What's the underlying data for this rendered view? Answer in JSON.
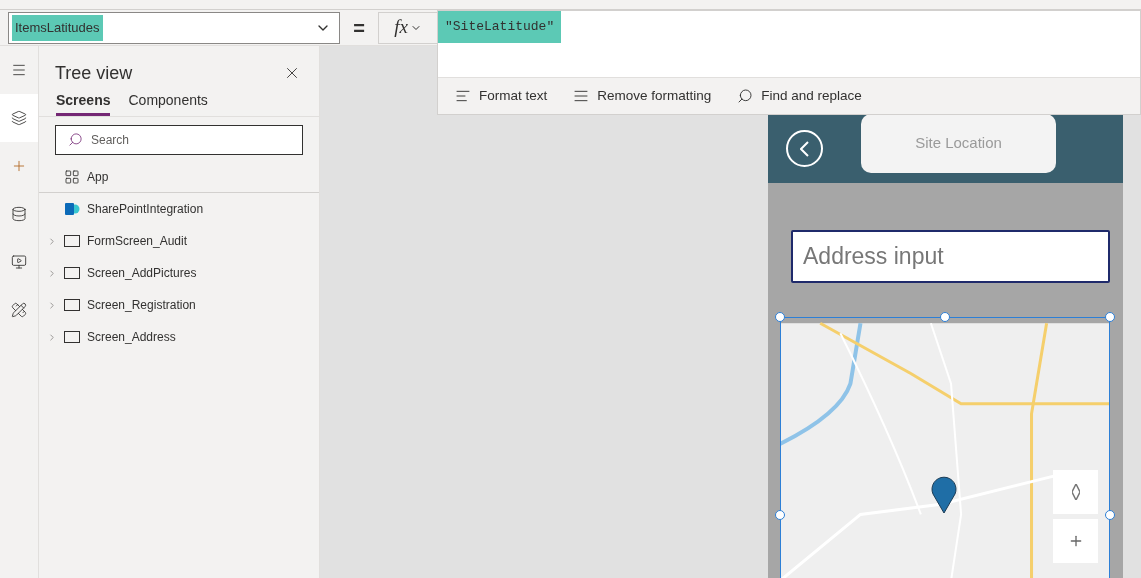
{
  "property_selector": {
    "value": "ItemsLatitudes"
  },
  "equals_sign": "=",
  "fx_button": {
    "label": "fx"
  },
  "formula": {
    "value": "\"SiteLatitude\""
  },
  "formula_toolbar": [
    {
      "kind": "format",
      "label": "Format text"
    },
    {
      "kind": "remove",
      "label": "Remove formatting"
    },
    {
      "kind": "find",
      "label": "Find and replace"
    }
  ],
  "rail": [
    {
      "kind": "menu",
      "selected": false
    },
    {
      "kind": "layers",
      "selected": true
    },
    {
      "kind": "insert",
      "selected": false
    },
    {
      "kind": "data",
      "selected": false
    },
    {
      "kind": "media",
      "selected": false
    },
    {
      "kind": "tools",
      "selected": false
    }
  ],
  "tree_view": {
    "title": "Tree view",
    "tabs": [
      {
        "label": "Screens",
        "selected": true
      },
      {
        "label": "Components",
        "selected": false
      }
    ],
    "search": {
      "placeholder": "Search"
    },
    "items": [
      {
        "label": "App",
        "kind": "app",
        "expandable": false
      },
      {
        "label": "SharePointIntegration",
        "kind": "sharepoint",
        "expandable": false
      },
      {
        "label": "FormScreen_Audit",
        "kind": "screen",
        "expandable": true
      },
      {
        "label": "Screen_AddPictures",
        "kind": "screen",
        "expandable": true
      },
      {
        "label": "Screen_Registration",
        "kind": "screen",
        "expandable": true
      },
      {
        "label": "Screen_Address",
        "kind": "screen",
        "expandable": true
      }
    ]
  },
  "canvas": {
    "header_button": "Site Location",
    "address_input": {
      "placeholder": "Address input"
    },
    "map": {
      "selected": true
    }
  }
}
